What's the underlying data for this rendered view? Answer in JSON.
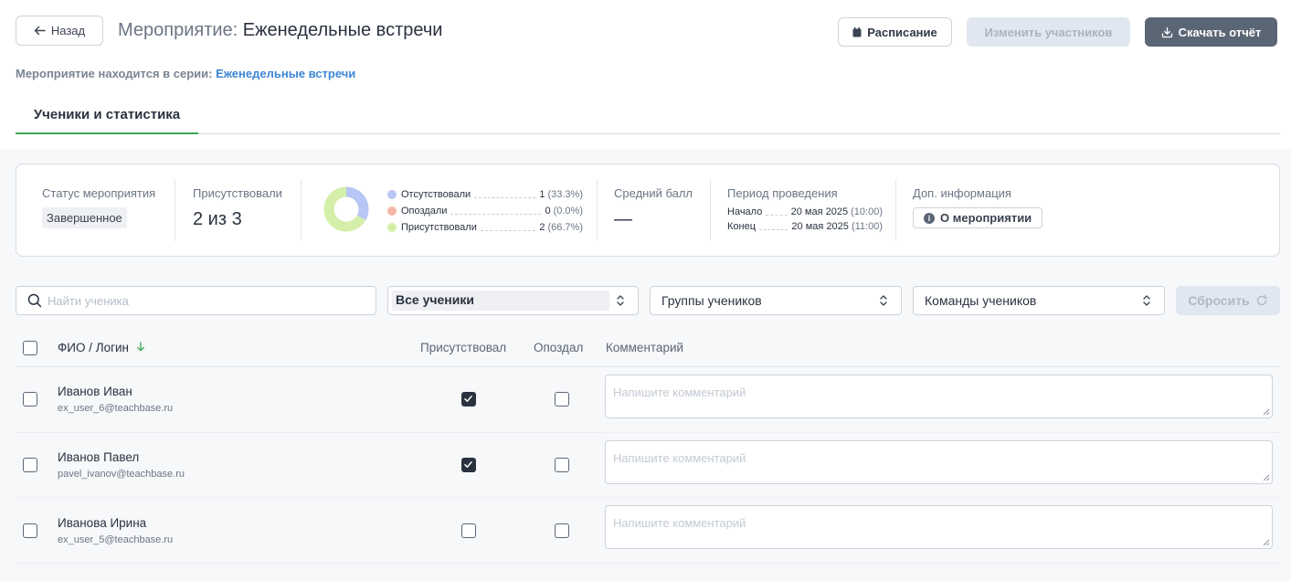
{
  "header": {
    "back_label": "Назад",
    "title_prefix": "Мероприятие:",
    "title": "Еженедельные встречи",
    "schedule_label": "Расписание",
    "change_participants_label": "Изменить участников",
    "download_report_label": "Скачать отчёт",
    "series_text": "Мероприятие находится в серии:",
    "series_link": "Еженедельные встречи"
  },
  "tabs": [
    {
      "label": "Ученики и статистика",
      "active": true
    }
  ],
  "stats": {
    "status_label": "Статус мероприятия",
    "status_value": "Завершенное",
    "attended_label": "Присутствовали",
    "attended_value": "2 из 3",
    "legend": [
      {
        "label": "Отсутствовали",
        "count": "1",
        "pct": "(33.3%)",
        "color": "#b8c6f5"
      },
      {
        "label": "Опоздали",
        "count": "0",
        "pct": "(0.0%)",
        "color": "#f5b8a6"
      },
      {
        "label": "Присутствовали",
        "count": "2",
        "pct": "(66.7%)",
        "color": "#d4efaa"
      }
    ],
    "donut": {
      "absent_fraction": 0.333,
      "late_fraction": 0.0,
      "present_fraction": 0.667
    },
    "avg_label": "Средний балл",
    "avg_value": "—",
    "period_label": "Период проведения",
    "start_label": "Начало",
    "start_date": "20 мая 2025",
    "start_time": "(10:00)",
    "end_label": "Конец",
    "end_date": "20 мая 2025",
    "end_time": "(11:00)",
    "extra_label": "Доп. информация",
    "about_label": "О мероприятии"
  },
  "filters": {
    "search_placeholder": "Найти ученика",
    "students_select": "Все ученики",
    "groups_select": "Группы учеников",
    "teams_select": "Команды учеников",
    "reset_label": "Сбросить"
  },
  "table": {
    "col_name": "ФИО / Логин",
    "col_attended": "Присутствовал",
    "col_late": "Опоздал",
    "col_comment": "Комментарий",
    "comment_placeholder": "Напишите комментарий",
    "rows": [
      {
        "name": "Иванов Иван",
        "login": "ex_user_6@teachbase.ru",
        "attended": true,
        "late": false
      },
      {
        "name": "Иванов Павел",
        "login": "pavel_ivanov@teachbase.ru",
        "attended": true,
        "late": false
      },
      {
        "name": "Иванова Ирина",
        "login": "ex_user_5@teachbase.ru",
        "attended": false,
        "late": false
      }
    ]
  },
  "colors": {
    "accent_green": "#3aa655",
    "link_blue": "#3e86d6",
    "primary_button": "#5b6675"
  }
}
